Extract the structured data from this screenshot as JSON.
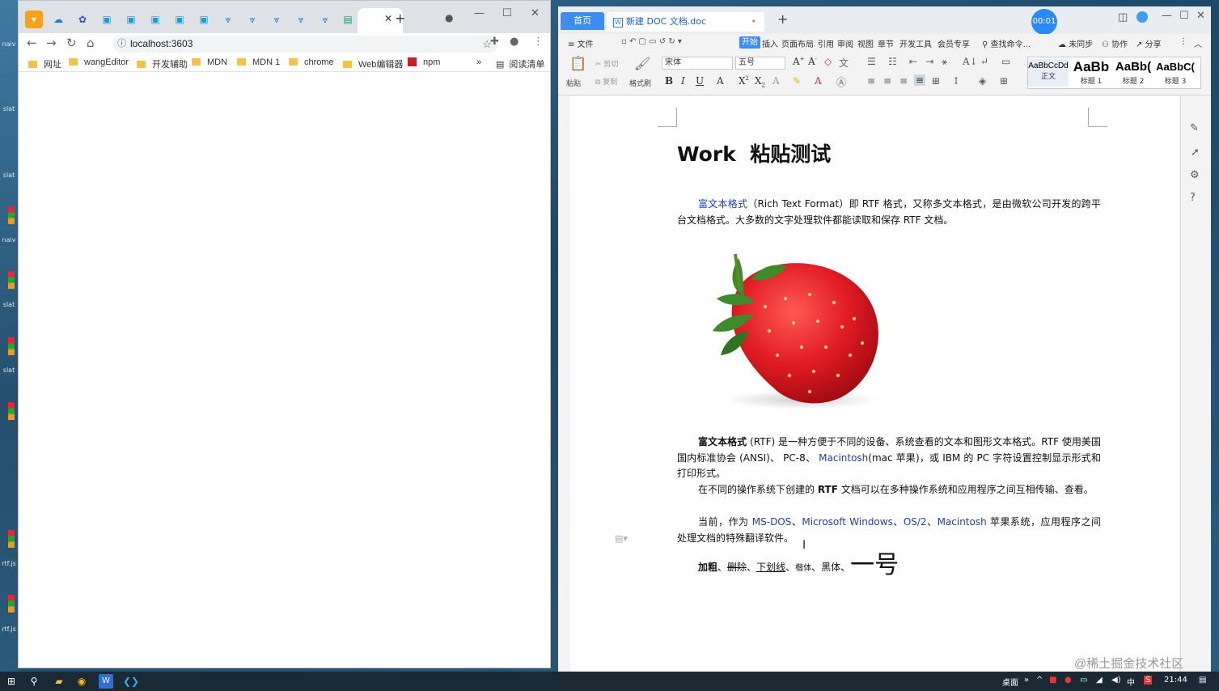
{
  "desktop": {
    "labels": [
      "naiv",
      "slat",
      "slat",
      "naiv",
      "slat",
      "slat",
      "rtf.js",
      "rtf.js"
    ]
  },
  "browser": {
    "url": "localhost:3603",
    "bookmarks": [
      "网址",
      "wangEditor",
      "开发辅助",
      "MDN",
      "MDN 1",
      "chrome",
      "Web编辑器",
      "npm"
    ],
    "more": "»",
    "reading_list": "阅读清单"
  },
  "wps": {
    "home_tab": "首页",
    "doc_tab": "新建 DOC 文档.doc",
    "timer": "00:01",
    "menus": [
      "≡ 文件",
      "开始",
      "插入",
      "页面布局",
      "引用",
      "审阅",
      "视图",
      "章节",
      "开发工具",
      "会员专享"
    ],
    "search": "查找命令...",
    "right_menu": [
      "未同步",
      "协作",
      "分享"
    ],
    "ribbon": {
      "paste": "粘贴",
      "cut": "剪切",
      "copy": "复制",
      "format_painter": "格式刷",
      "font": "宋体",
      "size": "五号"
    },
    "styles": [
      {
        "sample": "AaBbCcDd",
        "name": "正文"
      },
      {
        "sample": "AaBb",
        "name": "标题 1"
      },
      {
        "sample": "AaBb(",
        "name": "标题 2"
      },
      {
        "sample": "AaBbC(",
        "name": "标题 3"
      }
    ]
  },
  "doc": {
    "title": "Work  粘贴测试",
    "p1_link": "富文本格式",
    "p1_rest": "（Rich Text Format）即 RTF 格式，又称多文本格式，是由微软公司开发的跨平台文档格式。大多数的文字处理软件都能读取和保存 RTF 文档。",
    "p2_bold": "富文本格式",
    "p2_a": " (RTF) 是一种方便于不同的设备、系统查看的文本和图形文本格式。RTF 使用美国国内标准协会 (ANSI)、 PC-8、 ",
    "p2_link": "Macintosh",
    "p2_b": "(mac 苹果)，或 IBM 的 PC 字符设置控制显示形式和打印形式。",
    "p3_a": "在不同的操作系统下创建的 ",
    "p3_bold": "RTF",
    "p3_b": " 文档可以在多种操作系统和应用程序之间互相传输、查看。",
    "p4_a": "当前，作为 ",
    "p4_l1": "MS-DOS",
    "p4_s1": "、",
    "p4_l2": "Microsoft Windows",
    "p4_s2": "、",
    "p4_l3": "OS/2",
    "p4_s3": "、",
    "p4_l4": "Macintosh",
    "p4_b": " 苹果系统，应用程序之间处理文档的特殊翻译软件。",
    "f_bold": "加粗",
    "f_sep1": "、",
    "f_strike": "删除",
    "f_sep2": "、",
    "f_under": "下划线",
    "f_sep3": "、",
    "f_kai": "楷体",
    "f_sep4": "、",
    "f_hei": "黑体",
    "f_sep5": "、",
    "f_big": "一号"
  },
  "taskbar": {
    "desk_label": "桌面",
    "ime": "中",
    "time": "21:44"
  },
  "watermark": "@稀土掘金技术社区"
}
